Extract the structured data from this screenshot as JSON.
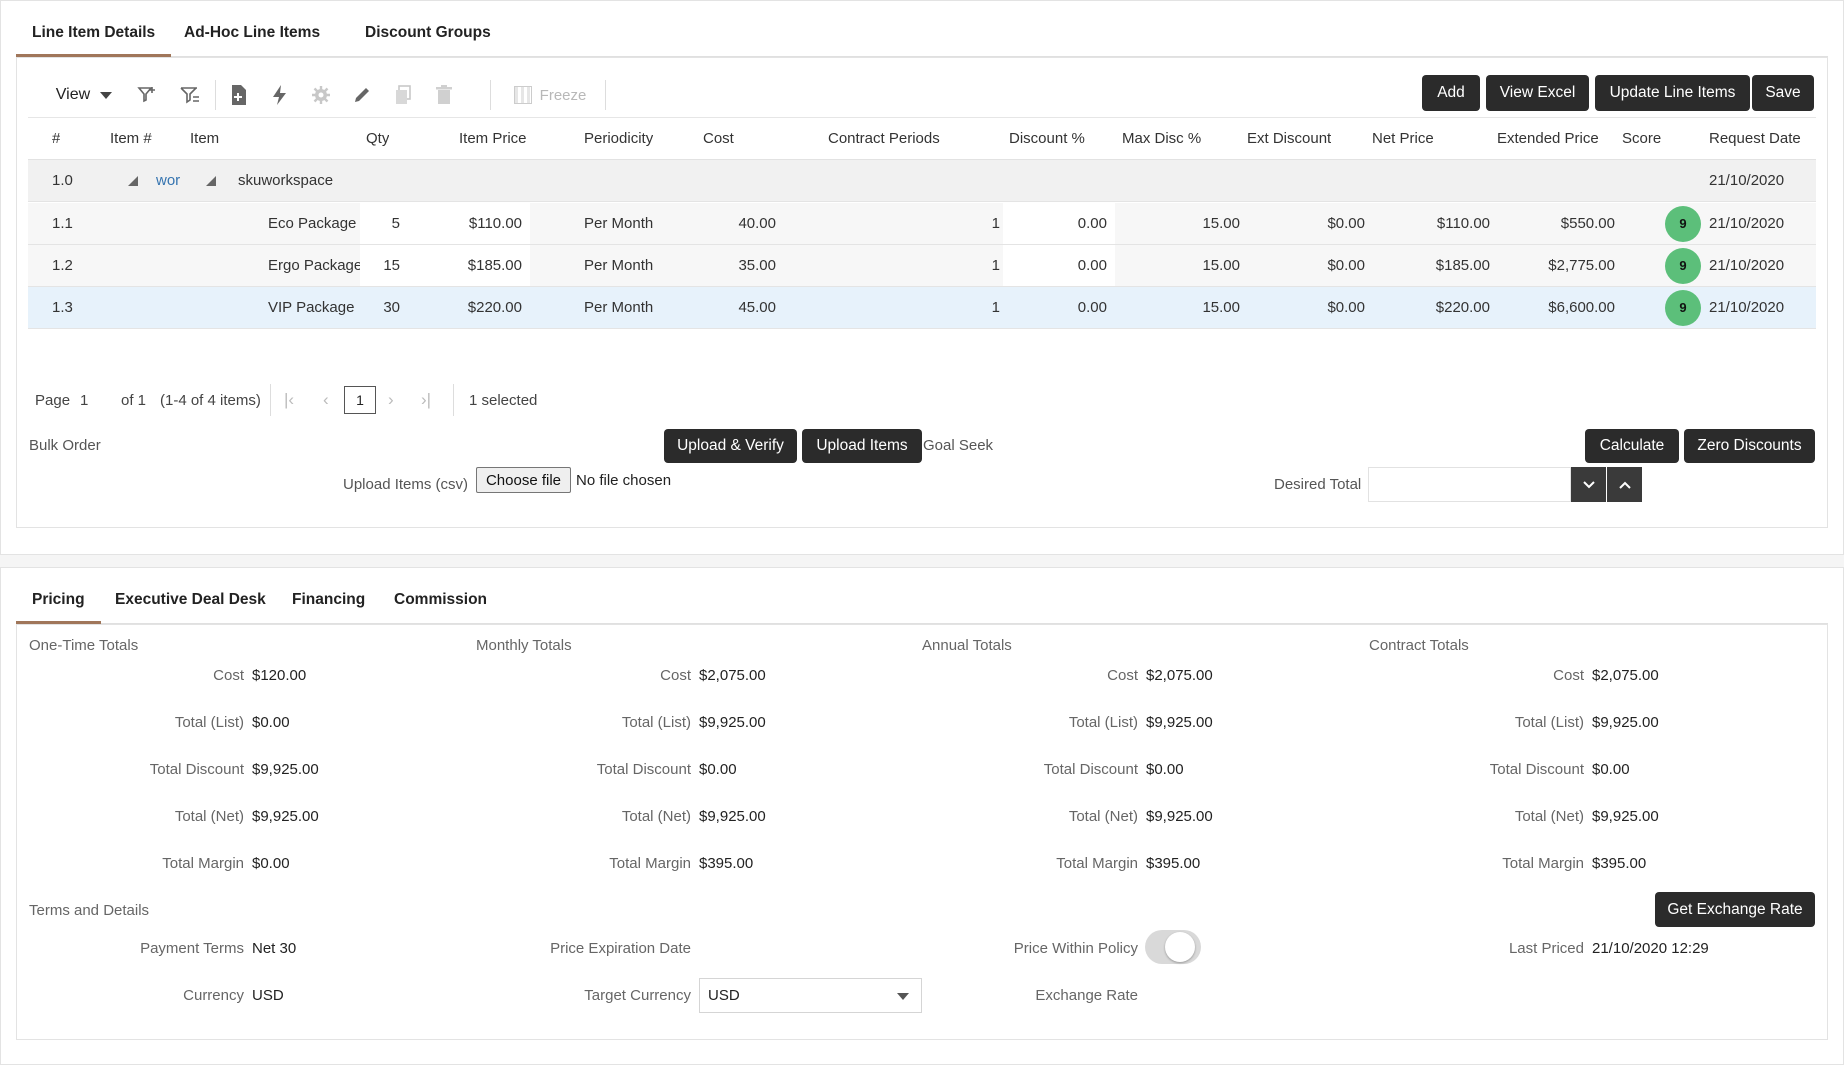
{
  "top_tabs": [
    "Line Item Details",
    "Ad-Hoc Line Items",
    "Discount Groups"
  ],
  "toolbar": {
    "view_label": "View",
    "freeze_label": "Freeze",
    "buttons": [
      "Add",
      "View Excel",
      "Update Line Items",
      "Save"
    ]
  },
  "grid": {
    "columns": [
      "#",
      "Item #",
      "Item",
      "Qty",
      "Item Price",
      "Periodicity",
      "Cost",
      "Contract Periods",
      "Discount %",
      "Max Disc %",
      "Ext Discount",
      "Net Price",
      "Extended Price",
      "Score",
      "Request Date"
    ],
    "group": {
      "num": "1.0",
      "item_num": "wor",
      "item": "skuworkspace",
      "request_date": "21/10/2020"
    },
    "rows": [
      {
        "num": "1.1",
        "item": "Eco Package",
        "qty": "5",
        "item_price": "$110.00",
        "periodicity": "Per Month",
        "cost": "40.00",
        "contract_periods": "1",
        "discount": "0.00",
        "max_disc": "15.00",
        "ext_discount": "$0.00",
        "net_price": "$110.00",
        "extended_price": "$550.00",
        "score": "9",
        "request_date": "21/10/2020"
      },
      {
        "num": "1.2",
        "item": "Ergo Package",
        "qty": "15",
        "item_price": "$185.00",
        "periodicity": "Per Month",
        "cost": "35.00",
        "contract_periods": "1",
        "discount": "0.00",
        "max_disc": "15.00",
        "ext_discount": "$0.00",
        "net_price": "$185.00",
        "extended_price": "$2,775.00",
        "score": "9",
        "request_date": "21/10/2020"
      },
      {
        "num": "1.3",
        "item": "VIP Package",
        "qty": "30",
        "item_price": "$220.00",
        "periodicity": "Per Month",
        "cost": "45.00",
        "contract_periods": "1",
        "discount": "0.00",
        "max_disc": "15.00",
        "ext_discount": "$0.00",
        "net_price": "$220.00",
        "extended_price": "$6,600.00",
        "score": "9",
        "request_date": "21/10/2020"
      }
    ]
  },
  "pager": {
    "page_label": "Page",
    "page_value": "1",
    "of_label": "of 1",
    "items_info": "(1-4 of 4 items)",
    "current_page": "1",
    "selected_info": "1 selected"
  },
  "bulk": {
    "bulk_order_label": "Bulk Order",
    "upload_verify": "Upload & Verify",
    "upload_items": "Upload Items",
    "goal_seek_label": "Goal Seek",
    "calculate": "Calculate",
    "zero_discounts": "Zero Discounts",
    "upload_csv_label": "Upload Items (csv)",
    "choose_file": "Choose file",
    "no_file": "No file chosen",
    "desired_total_label": "Desired Total",
    "desired_total_value": ""
  },
  "bottom_tabs": [
    "Pricing",
    "Executive Deal Desk",
    "Financing",
    "Commission"
  ],
  "totals": [
    {
      "title": "One-Time Totals",
      "cost": "$120.00",
      "total_list": "$0.00",
      "total_discount": "$9,925.00",
      "total_net": "$9,925.00",
      "total_margin": "$0.00"
    },
    {
      "title": "Monthly Totals",
      "cost": "$2,075.00",
      "total_list": "$9,925.00",
      "total_discount": "$0.00",
      "total_net": "$9,925.00",
      "total_margin": "$395.00"
    },
    {
      "title": "Annual Totals",
      "cost": "$2,075.00",
      "total_list": "$9,925.00",
      "total_discount": "$0.00",
      "total_net": "$9,925.00",
      "total_margin": "$395.00"
    },
    {
      "title": "Contract Totals",
      "cost": "$2,075.00",
      "total_list": "$9,925.00",
      "total_discount": "$0.00",
      "total_net": "$9,925.00",
      "total_margin": "$395.00"
    }
  ],
  "total_labels": {
    "cost": "Cost",
    "total_list": "Total (List)",
    "total_discount": "Total Discount",
    "total_net": "Total (Net)",
    "total_margin": "Total Margin"
  },
  "terms": {
    "title": "Terms and Details",
    "get_exchange_rate": "Get Exchange Rate",
    "payment_terms_label": "Payment Terms",
    "payment_terms_value": "Net 30",
    "price_expiration_label": "Price Expiration Date",
    "price_within_policy_label": "Price Within Policy",
    "price_within_policy": false,
    "last_priced_label": "Last Priced",
    "last_priced_value": "21/10/2020 12:29",
    "currency_label": "Currency",
    "currency_value": "USD",
    "target_currency_label": "Target Currency",
    "target_currency_value": "USD",
    "exchange_rate_label": "Exchange Rate"
  },
  "colors": {
    "accent_tab": "#a0765a",
    "button_dark": "#2b2b2b",
    "score_green": "#5cbf7a",
    "link_blue": "#3574b0",
    "selected_row": "#e7f2fb"
  }
}
